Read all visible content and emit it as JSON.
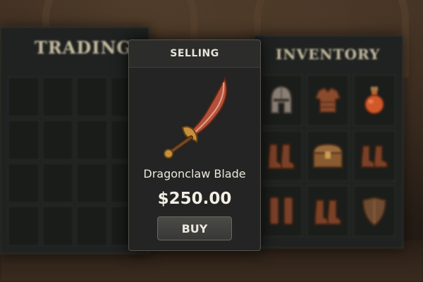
{
  "trading": {
    "title": "TRADING"
  },
  "selling": {
    "title": "SELLING",
    "item_name": "Dragonclaw Blade",
    "price": "$250.00",
    "buy_label": "BUY",
    "item_icon": "curved-sword-icon"
  },
  "inventory": {
    "title": "INVENTORY",
    "items": [
      {
        "icon": "helmet-icon"
      },
      {
        "icon": "chest-armor-icon"
      },
      {
        "icon": "potion-icon"
      },
      {
        "icon": "boots-icon"
      },
      {
        "icon": "treasure-chest-icon"
      },
      {
        "icon": "boots-icon"
      },
      {
        "icon": "greaves-icon"
      },
      {
        "icon": "boots-icon"
      },
      {
        "icon": "shield-icon"
      }
    ]
  },
  "colors": {
    "panel": "#232423",
    "accent_text": "#c9bda2",
    "blade": "#b4503a",
    "hilt": "#c8903a"
  }
}
